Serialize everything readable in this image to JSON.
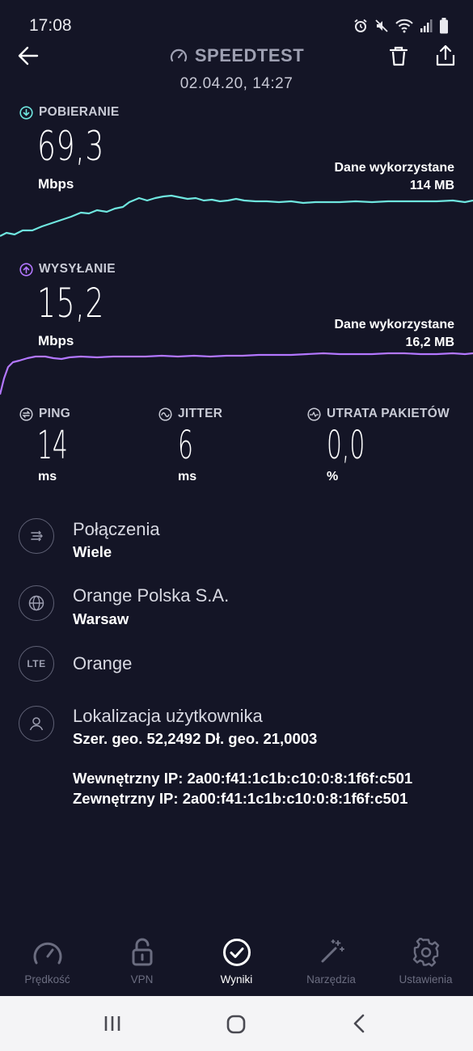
{
  "status_bar": {
    "time": "17:08",
    "icons": [
      "alarm-icon",
      "mute-icon",
      "wifi-icon",
      "signal-icon",
      "battery-icon"
    ]
  },
  "header": {
    "title": "SPEEDTEST",
    "date": "02.04.20, 14:27",
    "icons": [
      "back-arrow-icon",
      "speedometer-icon",
      "trash-icon",
      "share-icon"
    ]
  },
  "download": {
    "label": "POBIERANIE",
    "value": "69,3",
    "unit": "Mbps",
    "used_label": "Dane wykorzystane",
    "used_value": "114 MB",
    "color": "#6fe6df"
  },
  "upload": {
    "label": "WYSYŁANIE",
    "value": "15,2",
    "unit": "Mbps",
    "used_label": "Dane wykorzystane",
    "used_value": "16,2 MB",
    "color": "#b377ff"
  },
  "metrics": {
    "ping": {
      "label": "PING",
      "value": "14",
      "unit": "ms"
    },
    "jitter": {
      "label": "JITTER",
      "value": "6",
      "unit": "ms"
    },
    "loss": {
      "label": "UTRATA PAKIETÓW",
      "value": "0,0",
      "unit": "%"
    }
  },
  "info": {
    "connections": {
      "title": "Połączenia",
      "sub": "Wiele"
    },
    "provider": {
      "title": "Orange Polska S.A.",
      "sub": "Warsaw"
    },
    "network": {
      "badge": "LTE",
      "title": "Orange"
    },
    "location": {
      "title": "Lokalizacja użytkownika",
      "coords": "Szer. geo. 52,2492 Dł. geo. 21,0003",
      "internal_ip": "Wewnętrzny IP: 2a00:f41:1c1b:c10:0:8:1f6f:c501",
      "external_ip": "Zewnętrzny IP: 2a00:f41:1c1b:c10:0:8:1f6f:c501"
    }
  },
  "nav": {
    "items": [
      {
        "label": "Prędkość",
        "icon": "speedometer-icon"
      },
      {
        "label": "VPN",
        "icon": "unlock-icon"
      },
      {
        "label": "Wyniki",
        "icon": "check-circle-icon",
        "active": true
      },
      {
        "label": "Narzędzia",
        "icon": "magic-wand-icon"
      },
      {
        "label": "Ustawienia",
        "icon": "gear-icon"
      }
    ]
  },
  "colors": {
    "background": "#141526",
    "download_accent": "#6fe6df",
    "upload_accent": "#b377ff"
  }
}
